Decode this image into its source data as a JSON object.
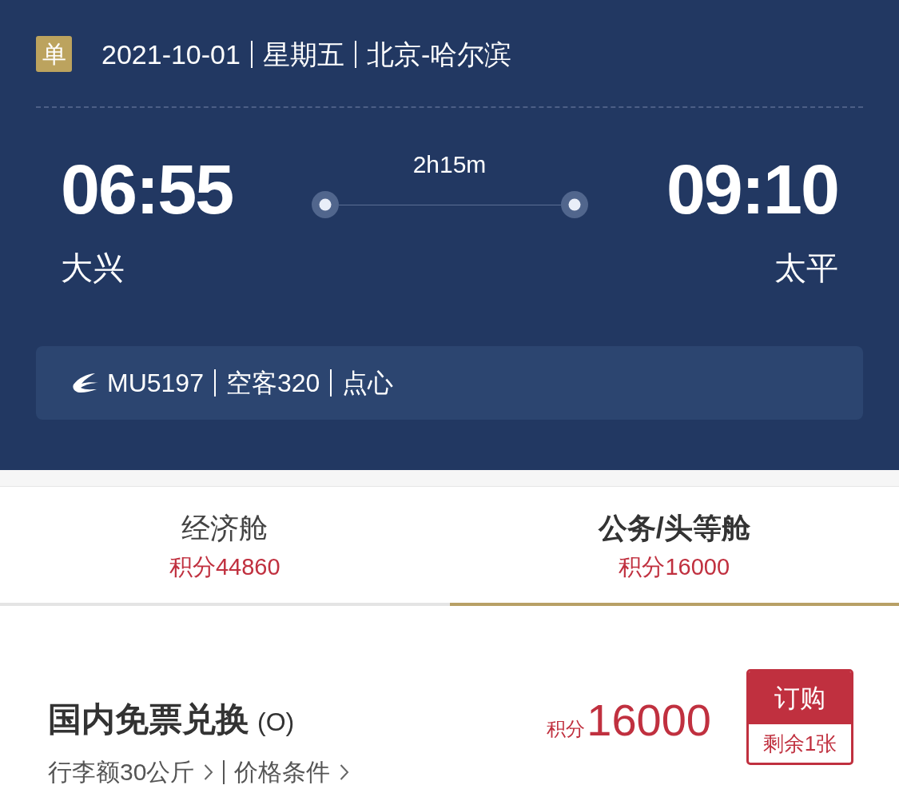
{
  "header": {
    "badge": "单",
    "date": "2021-10-01",
    "weekday": "星期五",
    "route": "北京-哈尔滨"
  },
  "flight": {
    "departure": {
      "time": "06:55",
      "airport": "大兴"
    },
    "duration": "2h15m",
    "arrival": {
      "time": "09:10",
      "airport": "太平"
    }
  },
  "info": {
    "flight_no": "MU5197",
    "aircraft": "空客320",
    "meal": "点心"
  },
  "tabs": [
    {
      "label": "经济舱",
      "points": "积分44860",
      "selected": false
    },
    {
      "label": "公务/头等舱",
      "points": "积分16000",
      "selected": true
    }
  ],
  "product": {
    "name": "国内免票兑换",
    "class_code": "(O)",
    "links": [
      "行李额30公斤",
      "价格条件"
    ],
    "price_prefix": "积分",
    "price": "16000",
    "button": "订购",
    "remaining": "剩余1张"
  }
}
